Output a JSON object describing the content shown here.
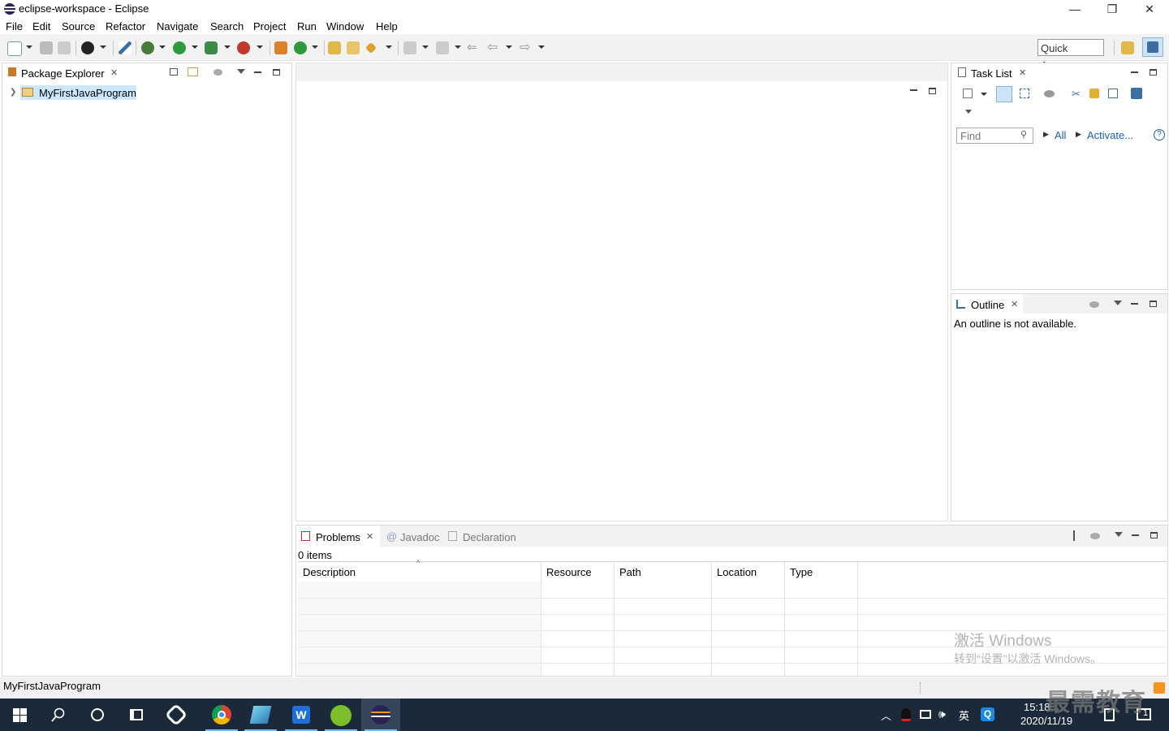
{
  "window": {
    "title": "eclipse-workspace - Eclipse",
    "controls": [
      "—",
      "❐",
      "✕"
    ]
  },
  "menu": [
    "File",
    "Edit",
    "Source",
    "Refactor",
    "Navigate",
    "Search",
    "Project",
    "Run",
    "Window",
    "Help"
  ],
  "toolbar": {
    "quick_access": "Quick Access"
  },
  "package_explorer": {
    "tab": "Package Explorer",
    "tree": [
      {
        "label": "MyFirstJavaProgram",
        "expanded": false,
        "selected": true
      }
    ]
  },
  "task_list": {
    "tab": "Task List",
    "find_placeholder": "Find",
    "filter_all": "All",
    "activate": "Activate...",
    "help": "?"
  },
  "outline": {
    "tab": "Outline",
    "message": "An outline is not available."
  },
  "bottom_panel": {
    "tabs": [
      {
        "label": "Problems",
        "active": true
      },
      {
        "label": "Javadoc",
        "active": false
      },
      {
        "label": "Declaration",
        "active": false
      }
    ],
    "summary": "0 items",
    "columns": [
      "Description",
      "Resource",
      "Path",
      "Location",
      "Type"
    ]
  },
  "watermark": {
    "line1": "激活 Windows",
    "line2": "转到“设置”以激活 Windows。"
  },
  "statusbar": {
    "text": "MyFirstJavaProgram"
  },
  "taskbar": {
    "time": "15:18",
    "date": "2020/11/19",
    "ime": "英",
    "brand_overlay": "最需教育",
    "notification_count": "1"
  },
  "colors": {
    "accent": "#3399ff",
    "link": "#1a5fb4",
    "taskbar": "#1b2a3a",
    "selection": "#cce8ff"
  }
}
